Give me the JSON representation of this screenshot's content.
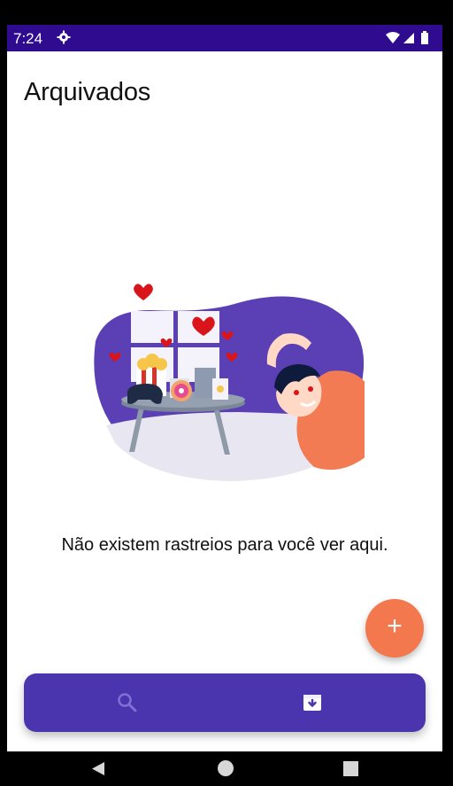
{
  "status_bar": {
    "time": "7:24"
  },
  "screen": {
    "title": "Arquivados",
    "empty_message": "Não existem rastreios para você ver aqui."
  },
  "fab": {
    "label": "+"
  },
  "bottom_nav": {
    "items": [
      {
        "name": "search",
        "active": false
      },
      {
        "name": "archive",
        "active": true
      }
    ]
  },
  "colors": {
    "status_bar": "#2e0b8f",
    "primary": "#4a35ae",
    "accent": "#f3784e",
    "illustration_blob": "#5b3fb4"
  }
}
